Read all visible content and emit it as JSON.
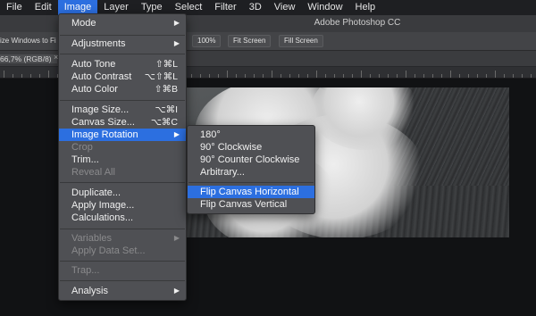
{
  "menubar": {
    "items": [
      "File",
      "Edit",
      "Image",
      "Layer",
      "Type",
      "Select",
      "Filter",
      "3D",
      "View",
      "Window",
      "Help"
    ],
    "active": "Image"
  },
  "titlebar": {
    "title": "Adobe Photoshop CC"
  },
  "options": {
    "resize_text": "ize Windows to Fi",
    "buttons": [
      "100%",
      "Fit Screen",
      "Fill Screen"
    ]
  },
  "doc_tab": {
    "label": "66,7% (RGB/8)",
    "close": "×"
  },
  "image_menu": {
    "items": [
      {
        "label": "Mode",
        "submenu": true
      },
      {
        "label": "Adjustments",
        "submenu": true
      },
      {
        "label": "Auto Tone",
        "shortcut": "⇧⌘L"
      },
      {
        "label": "Auto Contrast",
        "shortcut": "⌥⇧⌘L"
      },
      {
        "label": "Auto Color",
        "shortcut": "⇧⌘B"
      },
      {
        "label": "Image Size...",
        "shortcut": "⌥⌘I"
      },
      {
        "label": "Canvas Size...",
        "shortcut": "⌥⌘C"
      },
      {
        "label": "Image Rotation",
        "submenu": true,
        "highlighted": true
      },
      {
        "label": "Crop",
        "disabled": true
      },
      {
        "label": "Trim..."
      },
      {
        "label": "Reveal All",
        "disabled": true
      },
      {
        "label": "Duplicate..."
      },
      {
        "label": "Apply Image..."
      },
      {
        "label": "Calculations..."
      },
      {
        "label": "Variables",
        "submenu": true,
        "disabled": true
      },
      {
        "label": "Apply Data Set...",
        "disabled": true
      },
      {
        "label": "Trap...",
        "disabled": true
      },
      {
        "label": "Analysis",
        "submenu": true
      }
    ]
  },
  "rotation_submenu": {
    "items": [
      {
        "label": "180°"
      },
      {
        "label": "90° Clockwise"
      },
      {
        "label": "90° Counter Clockwise"
      },
      {
        "label": "Arbitrary..."
      },
      {
        "label": "Flip Canvas Horizontal",
        "highlighted": true
      },
      {
        "label": "Flip Canvas Vertical"
      }
    ]
  },
  "colors": {
    "highlight": "#2c6fe0",
    "menu_bg": "#4f5054",
    "disabled_text": "#8a8a8c"
  },
  "icons": {
    "submenu_arrow": "▶"
  }
}
